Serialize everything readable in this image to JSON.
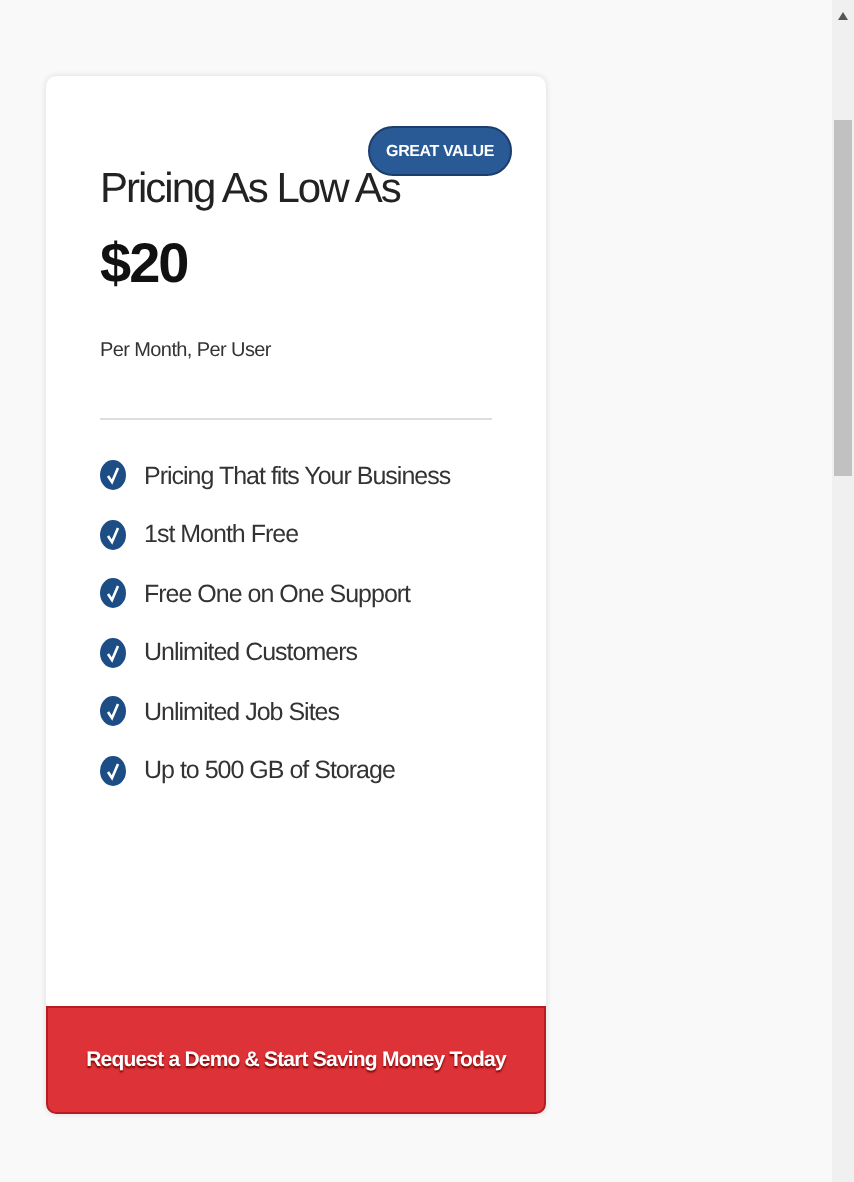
{
  "card": {
    "badge": "GREAT VALUE",
    "heading": "Pricing As Low As",
    "price": "$20",
    "period": "Per Month, Per User",
    "features": [
      "Pricing That fits Your Business",
      "1st Month Free",
      "Free One on One Support",
      "Unlimited Customers",
      "Unlimited Job Sites",
      "Up to 500 GB of Storage"
    ],
    "cta": "Request a Demo & Start Saving Money Today"
  }
}
